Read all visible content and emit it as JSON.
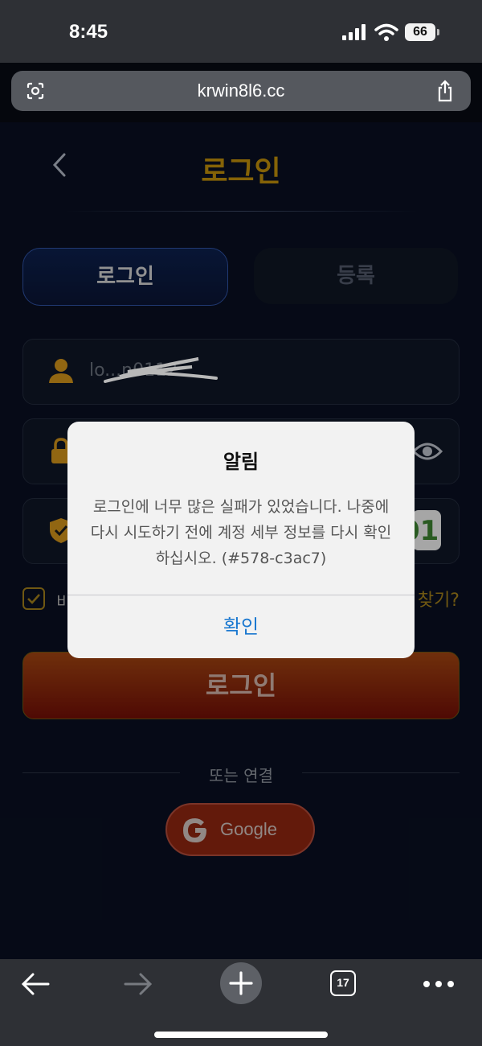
{
  "status_bar": {
    "time": "8:45",
    "battery": "66"
  },
  "browser": {
    "url": "krwin8l6.cc",
    "tabs_count": "17"
  },
  "page": {
    "title": "로그인",
    "tabs": [
      {
        "label": "로그인"
      },
      {
        "label": "등록"
      }
    ],
    "username_value": "lo...n0112",
    "remember_label": "비",
    "forgot_label": "찾기?",
    "login_button": "로그인",
    "or_text": "또는 연결",
    "google_label": "Google",
    "captcha_text": "01"
  },
  "alert": {
    "title": "알림",
    "message": "로그인에 너무 많은 실패가 있었습니다. 나중에 다시 시도하기 전에 계정 세부 정보를 다시 확인하십시오. (#578-c3ac7)",
    "confirm": "확인"
  },
  "colors": {
    "accent_gold": "#b98a0a",
    "alert_link": "#1a78d0",
    "login_red": "#8a2410"
  }
}
